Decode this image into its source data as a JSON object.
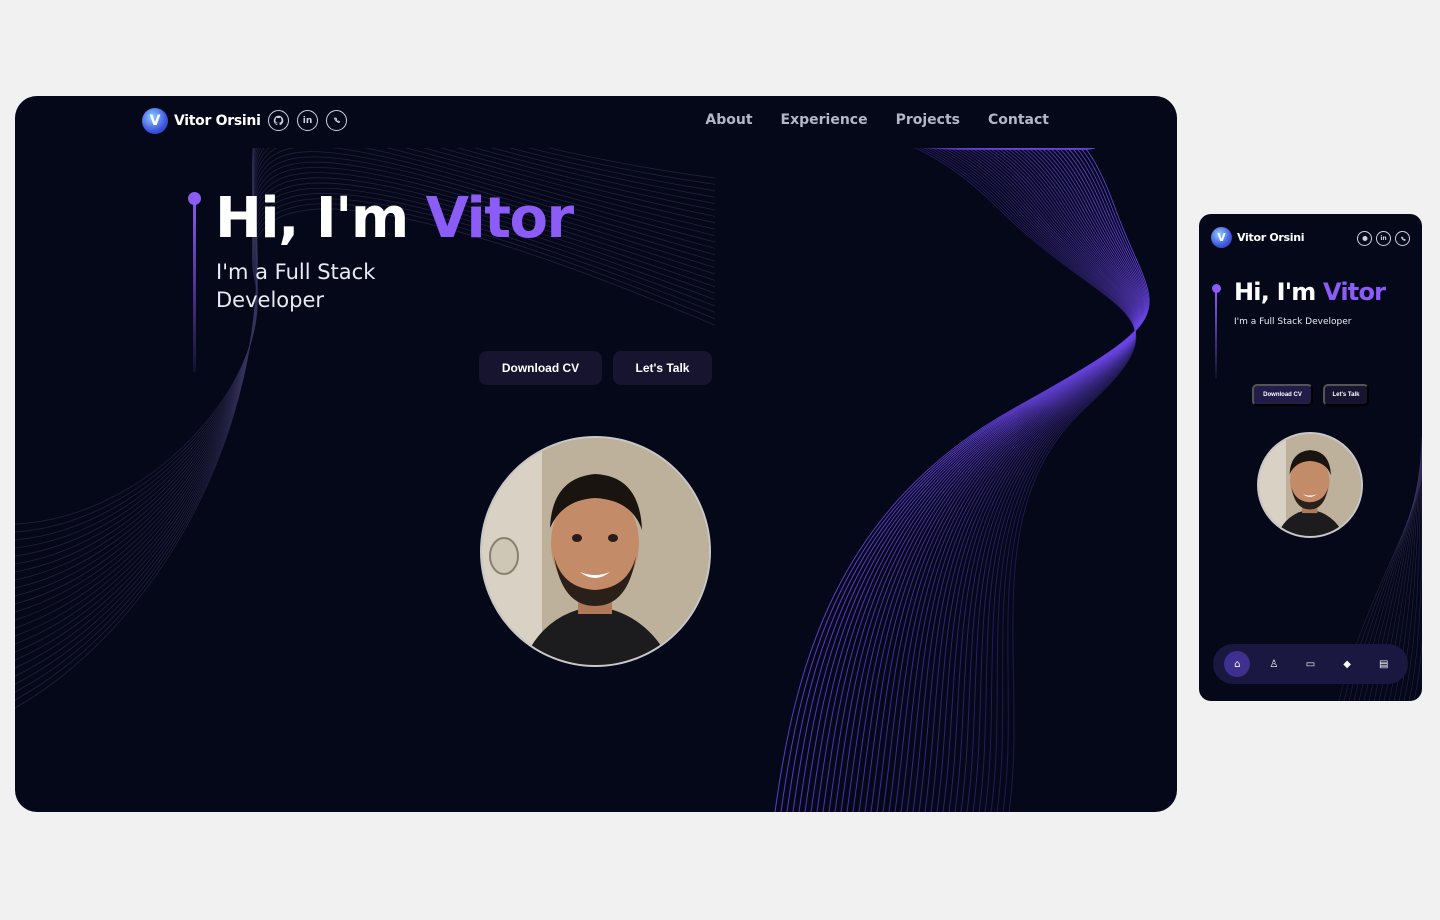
{
  "desktop": {
    "brand": {
      "name": "Vitor Orsini",
      "logo_glyph": "V"
    },
    "socials": [
      {
        "icon": "github-icon",
        "glyph": ""
      },
      {
        "icon": "linkedin-icon",
        "glyph": "in"
      },
      {
        "icon": "whatsapp-icon",
        "glyph": ""
      }
    ],
    "menu": [
      "About",
      "Experience",
      "Projects",
      "Contact"
    ],
    "hero": {
      "title_prefix": "Hi, I'm ",
      "title_accent": "Vitor",
      "subtitle": "I'm a Full Stack Developer",
      "btn_cv": "Download CV",
      "btn_talk": "Let's Talk"
    }
  },
  "mobile": {
    "brand": {
      "name": "Vitor Orsini",
      "logo_glyph": "V"
    },
    "hero": {
      "title_prefix": "Hi, I'm ",
      "title_accent": "Vitor",
      "subtitle": "I'm a Full Stack Developer",
      "btn_cv": "Download CV",
      "btn_talk": "Let's Talk"
    },
    "tabs": [
      {
        "icon": "home-icon",
        "glyph": "⌂",
        "active": true
      },
      {
        "icon": "user-icon",
        "glyph": "♙",
        "active": false
      },
      {
        "icon": "briefcase-icon",
        "glyph": "▭",
        "active": false
      },
      {
        "icon": "projects-icon",
        "glyph": "◆",
        "active": false
      },
      {
        "icon": "message-icon",
        "glyph": "▤",
        "active": false
      }
    ]
  },
  "colors": {
    "accent": "#8b5cf6",
    "background": "#050818",
    "page": "#f1f1f1",
    "button": "#17142f"
  }
}
